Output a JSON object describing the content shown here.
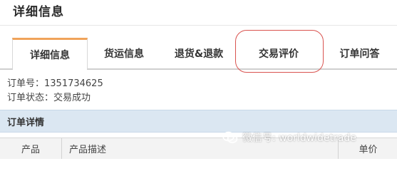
{
  "page": {
    "title": "详细信息"
  },
  "tabs": [
    {
      "label": "详细信息",
      "active": true
    },
    {
      "label": "货运信息",
      "active": false
    },
    {
      "label": "退货&退款",
      "active": false
    },
    {
      "label": "交易评价",
      "active": false,
      "highlighted": true
    },
    {
      "label": "订单问答",
      "active": false
    }
  ],
  "order": {
    "number_line": "订单号：1351734625",
    "status_line": "订单状态：交易成功"
  },
  "details": {
    "section_title": "订单详情",
    "columns": [
      "产品",
      "产品描述",
      "单价"
    ]
  },
  "watermark": {
    "text": "微信号: worldwidetrade",
    "icon": "wechat-icon"
  },
  "colors": {
    "active_tab_accent": "#f0a35a",
    "highlight_circle": "#d9534f",
    "section_header_bg": "#dbe7f2"
  }
}
